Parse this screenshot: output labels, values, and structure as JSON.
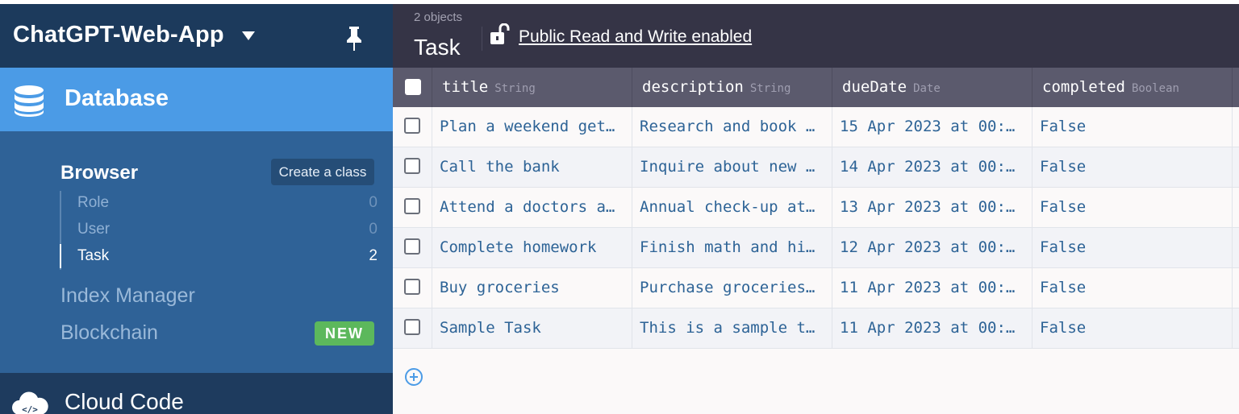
{
  "app": {
    "name": "ChatGPT-Web-App"
  },
  "sidebar": {
    "database_label": "Database",
    "browser_label": "Browser",
    "create_class_label": "Create a class",
    "classes": [
      {
        "name": "Role",
        "count": "0"
      },
      {
        "name": "User",
        "count": "0"
      },
      {
        "name": "Task",
        "count": "2"
      }
    ],
    "index_manager_label": "Index Manager",
    "blockchain_label": "Blockchain",
    "new_badge": "NEW",
    "cloud_code_label": "Cloud Code"
  },
  "toolbar": {
    "object_count": "2 objects",
    "class_name": "Task",
    "permission_link": "Public Read and Write enabled"
  },
  "grid": {
    "columns": [
      {
        "name": "title",
        "type": "String"
      },
      {
        "name": "description",
        "type": "String"
      },
      {
        "name": "dueDate",
        "type": "Date"
      },
      {
        "name": "completed",
        "type": "Boolean"
      }
    ],
    "rows": [
      {
        "title": "Plan a weekend get…",
        "description": "Research and book …",
        "dueDate": "15 Apr 2023 at 00:…",
        "completed": "False"
      },
      {
        "title": "Call the bank",
        "description": "Inquire about new …",
        "dueDate": "14 Apr 2023 at 00:…",
        "completed": "False"
      },
      {
        "title": "Attend a doctors a…",
        "description": "Annual check-up at…",
        "dueDate": "13 Apr 2023 at 00:…",
        "completed": "False"
      },
      {
        "title": "Complete homework",
        "description": "Finish math and hi…",
        "dueDate": "12 Apr 2023 at 00:…",
        "completed": "False"
      },
      {
        "title": "Buy groceries",
        "description": "Purchase groceries…",
        "dueDate": "11 Apr 2023 at 00:…",
        "completed": "False"
      },
      {
        "title": "Sample Task",
        "description": "This is a sample t…",
        "dueDate": "11 Apr 2023 at 00:…",
        "completed": "False"
      }
    ]
  },
  "colors": {
    "sidebar_bg": "#1e3b5e",
    "active_nav": "#4b9be6",
    "sub_panel": "#2f6297",
    "toolbar_bg": "#353446",
    "header_bg": "#5b5a6d",
    "cell_text": "#2d6396",
    "badge_green": "#5cb85c"
  },
  "icons": {
    "pin": "pin-icon",
    "database": "database-icon",
    "lock": "unlock-icon",
    "cloud": "cloud-code-icon",
    "add": "add-row-icon"
  }
}
